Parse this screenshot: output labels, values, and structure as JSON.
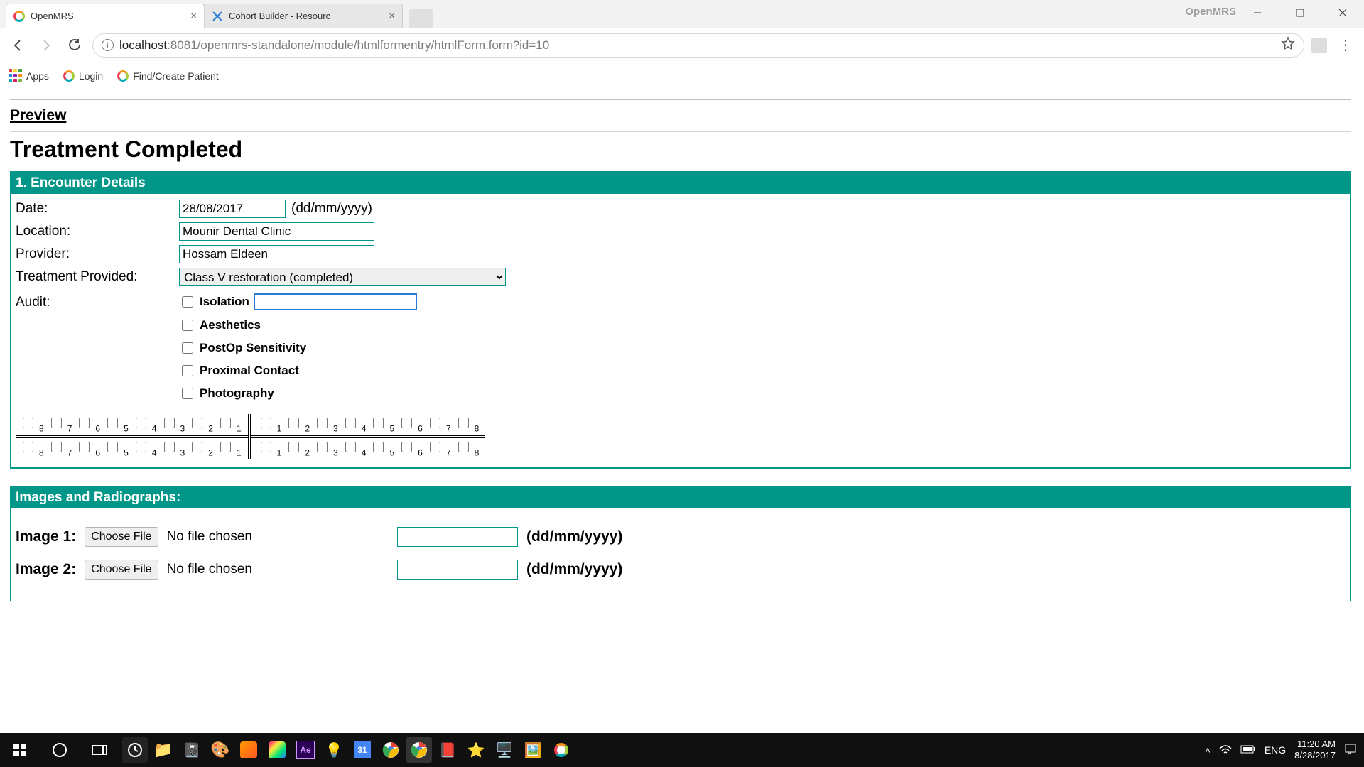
{
  "window": {
    "title": "OpenMRS"
  },
  "tabs": [
    {
      "title": "OpenMRS",
      "active": true
    },
    {
      "title": "Cohort Builder - Resourc",
      "active": false
    }
  ],
  "url": {
    "host": "localhost",
    "port": ":8081",
    "path": "/openmrs-standalone/module/htmlformentry/htmlForm.form?id=10"
  },
  "bookmarks": {
    "apps": "Apps",
    "login": "Login",
    "find": "Find/Create Patient"
  },
  "page": {
    "preview": "Preview",
    "title": "Treatment Completed",
    "section1": {
      "header": "1. Encounter Details",
      "date_label": "Date:",
      "date_value": "28/08/2017",
      "date_hint": "(dd/mm/yyyy)",
      "location_label": "Location:",
      "location_value": "Mounir Dental Clinic",
      "provider_label": "Provider:",
      "provider_value": "Hossam Eldeen",
      "treatment_label": "Treatment Provided:",
      "treatment_value": "Class V restoration (completed)",
      "audit_label": "Audit:",
      "audit_items": {
        "isolation": "Isolation",
        "aesthetics": "Aesthetics",
        "postop": "PostOp Sensitivity",
        "proximal": "Proximal Contact",
        "photo": "Photography"
      },
      "teeth_upper_left": [
        "8",
        "7",
        "6",
        "5",
        "4",
        "3",
        "2",
        "1"
      ],
      "teeth_upper_right": [
        "1",
        "2",
        "3",
        "4",
        "5",
        "6",
        "7",
        "8"
      ],
      "teeth_lower_left": [
        "8",
        "7",
        "6",
        "5",
        "4",
        "3",
        "2",
        "1"
      ],
      "teeth_lower_right": [
        "1",
        "2",
        "3",
        "4",
        "5",
        "6",
        "7",
        "8"
      ]
    },
    "section2": {
      "header": "Images and Radiographs:",
      "rows": [
        {
          "label": "Image 1:",
          "choose": "Choose File",
          "nofile": "No file chosen",
          "hint": "(dd/mm/yyyy)"
        },
        {
          "label": "Image 2:",
          "choose": "Choose File",
          "nofile": "No file chosen",
          "hint": "(dd/mm/yyyy)"
        }
      ]
    }
  },
  "tray": {
    "lang": "ENG",
    "time": "11:20 AM",
    "date": "8/28/2017"
  }
}
